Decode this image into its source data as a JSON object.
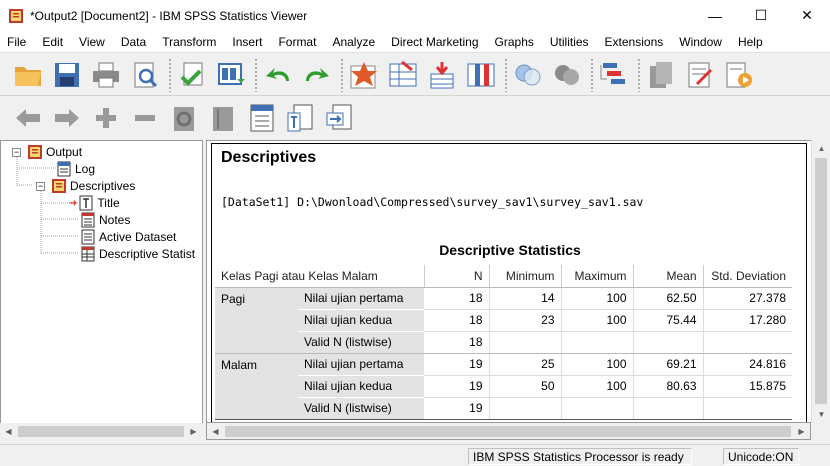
{
  "window": {
    "title": "*Output2 [Document2] - IBM SPSS Statistics Viewer",
    "minimize": "—",
    "maximize": "☐",
    "close": "✕"
  },
  "menu": [
    "File",
    "Edit",
    "View",
    "Data",
    "Transform",
    "Insert",
    "Format",
    "Analyze",
    "Direct Marketing",
    "Graphs",
    "Utilities",
    "Extensions",
    "Window",
    "Help"
  ],
  "outline": {
    "root": "Output",
    "log": "Log",
    "descriptives": "Descriptives",
    "children": [
      "Title",
      "Notes",
      "Active Dataset",
      "Descriptive Statist"
    ]
  },
  "output": {
    "heading": "Descriptives",
    "dataset": "[DataSet1] D:\\Dwonload\\Compressed\\survey_sav1\\survey_sav1.sav",
    "table_title": "Descriptive Statistics",
    "columns": {
      "group": "Kelas Pagi atau Kelas Malam",
      "n": "N",
      "min": "Minimum",
      "max": "Maximum",
      "mean": "Mean",
      "sd": "Std. Deviation"
    },
    "groups": [
      {
        "name": "Pagi",
        "rows": [
          {
            "label": "Nilai ujian pertama",
            "n": "18",
            "min": "14",
            "max": "100",
            "mean": "62.50",
            "sd": "27.378"
          },
          {
            "label": "Nilai ujian kedua",
            "n": "18",
            "min": "23",
            "max": "100",
            "mean": "75.44",
            "sd": "17.280"
          },
          {
            "label": "Valid N (listwise)",
            "n": "18",
            "min": "",
            "max": "",
            "mean": "",
            "sd": ""
          }
        ]
      },
      {
        "name": "Malam",
        "rows": [
          {
            "label": "Nilai ujian pertama",
            "n": "19",
            "min": "25",
            "max": "100",
            "mean": "69.21",
            "sd": "24.816"
          },
          {
            "label": "Nilai ujian kedua",
            "n": "19",
            "min": "50",
            "max": "100",
            "mean": "80.63",
            "sd": "15.875"
          },
          {
            "label": "Valid N (listwise)",
            "n": "19",
            "min": "",
            "max": "",
            "mean": "",
            "sd": ""
          }
        ]
      }
    ]
  },
  "status": {
    "processor": "IBM SPSS Statistics Processor is ready",
    "unicode": "Unicode:ON"
  }
}
